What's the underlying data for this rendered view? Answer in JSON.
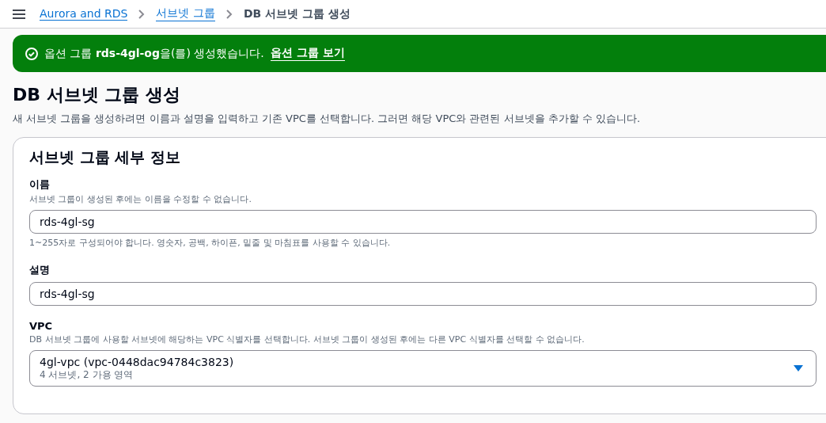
{
  "breadcrumbs": [
    {
      "label": "Aurora and RDS",
      "kind": "link"
    },
    {
      "label": "서브넷 그룹",
      "kind": "link"
    },
    {
      "label": "DB 서브넷 그룹 생성",
      "kind": "current"
    }
  ],
  "banner": {
    "kind": "success",
    "message": "옵션 그룹 **rds-4gl-og**을(를) 생성했습니다.",
    "link": "옵션 그룹 보기"
  },
  "page": {
    "title": "DB 서브넷 그룹 생성",
    "description": "새 서브넷 그룹을 생성하려면 이름과 설명을 입력하고 기존 VPC를 선택합니다. 그러면 해당 VPC와 관련된 서브넷을 추가할 수 있습니다."
  },
  "card": {
    "title": "서브넷 그룹 세부 정보",
    "fields": [
      {
        "kind": "input",
        "label": "이름",
        "hint": "서브넷 그룹이 생성된 후에는 이름을 수정할 수 없습니다.",
        "value": "rds-4gl-sg",
        "constraint": "1~255자로 구성되어야 합니다. 영숫자, 공백, 하이픈, 밑줄 및 마침표를 사용할 수 있습니다."
      },
      {
        "kind": "input",
        "label": "설명",
        "value": "rds-4gl-sg"
      },
      {
        "kind": "select",
        "label": "VPC",
        "hint": "DB 서브넷 그룹에 사용할 서브넷에 해당하는 VPC 식별자를 선택합니다. 서브넷 그룹이 생성된 후에는 다른 VPC 식별자를 선택할 수 없습니다.",
        "value": "4gl-vpc (vpc-0448dac94784c3823)",
        "secondary": "4 서브넷, 2 가용 영역"
      }
    ]
  }
}
